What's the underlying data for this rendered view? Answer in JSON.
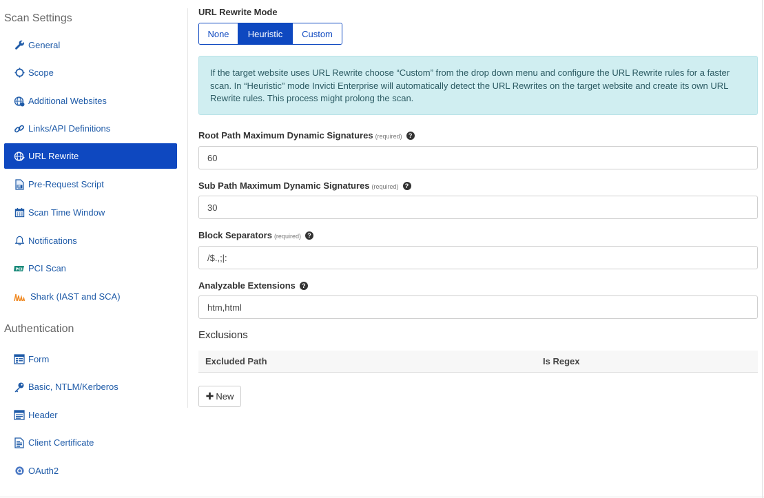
{
  "sidebar": {
    "scan_settings_title": "Scan Settings",
    "authentication_title": "Authentication",
    "items": [
      {
        "label": "General",
        "icon": "wrench-icon"
      },
      {
        "label": "Scope",
        "icon": "target-icon"
      },
      {
        "label": "Additional Websites",
        "icon": "globe-icon"
      },
      {
        "label": "Links/API Definitions",
        "icon": "link-icon"
      },
      {
        "label": "URL Rewrite",
        "icon": "globe-edit-icon"
      },
      {
        "label": "Pre-Request Script",
        "icon": "js-file-icon"
      },
      {
        "label": "Scan Time Window",
        "icon": "calendar-icon"
      },
      {
        "label": "Notifications",
        "icon": "bell-icon"
      },
      {
        "label": "PCI Scan",
        "icon": "pci-icon"
      },
      {
        "label": "Shark (IAST and SCA)",
        "icon": "shark-icon"
      }
    ],
    "auth_items": [
      {
        "label": "Form",
        "icon": "form-icon"
      },
      {
        "label": "Basic, NTLM/Kerberos",
        "icon": "key-icon"
      },
      {
        "label": "Header",
        "icon": "header-icon"
      },
      {
        "label": "Client Certificate",
        "icon": "certificate-icon"
      },
      {
        "label": "OAuth2",
        "icon": "oauth-icon"
      }
    ],
    "active_item": "URL Rewrite",
    "active_color": "#0e48c0",
    "link_color": "#1f5ba8"
  },
  "main": {
    "mode_label": "URL Rewrite Mode",
    "modes": [
      "None",
      "Heuristic",
      "Custom"
    ],
    "selected_mode": "Heuristic",
    "info_text": "If the target website uses URL Rewrite choose “Custom” from the drop down menu and configure the URL Rewrite rules for a faster scan. In “Heuristic” mode Invicti Enterprise will automatically detect the URL Rewrites on the target website and create its own URL Rewrite rules. This process might prolong the scan.",
    "fields": {
      "root_path": {
        "label": "Root Path Maximum Dynamic Signatures",
        "required": "(required)",
        "value": "60"
      },
      "sub_path": {
        "label": "Sub Path Maximum Dynamic Signatures",
        "required": "(required)",
        "value": "30"
      },
      "block_separators": {
        "label": "Block Separators",
        "required": "(required)",
        "value": "/$.,;|:"
      },
      "extensions": {
        "label": "Analyzable Extensions",
        "value": "htm,html"
      }
    },
    "exclusions": {
      "title": "Exclusions",
      "columns": [
        "Excluded Path",
        "Is Regex"
      ],
      "new_button": "New"
    }
  }
}
